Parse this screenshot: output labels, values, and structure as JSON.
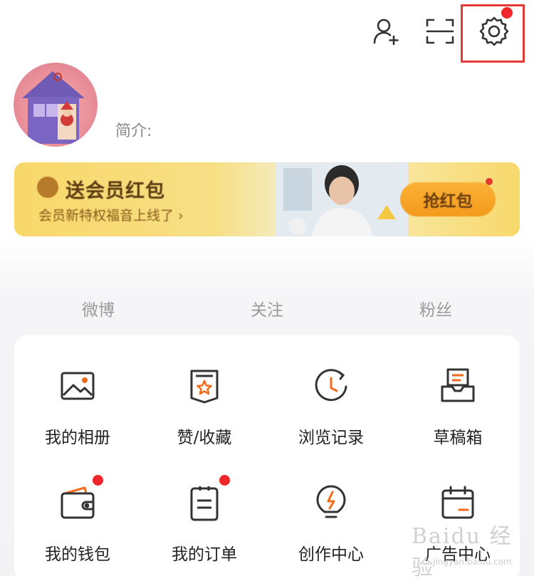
{
  "profile": {
    "bio_label": "简介:"
  },
  "banner": {
    "title": "送会员红包",
    "subtitle": "会员新特权福音上线了 ›",
    "button_label": "抢红包"
  },
  "stats": [
    "微博",
    "关注",
    "粉丝"
  ],
  "menu": {
    "row1": [
      "我的相册",
      "赞/收藏",
      "浏览记录",
      "草稿箱"
    ],
    "row2": [
      "我的钱包",
      "我的订单",
      "创作中心",
      "广告中心"
    ]
  },
  "watermark": {
    "text": "Baidu 经验",
    "sub": "jingyan.baidu.com"
  },
  "colors": {
    "accent": "#f26b1d",
    "notification": "#f0262b",
    "highlight_box": "#e53935"
  }
}
